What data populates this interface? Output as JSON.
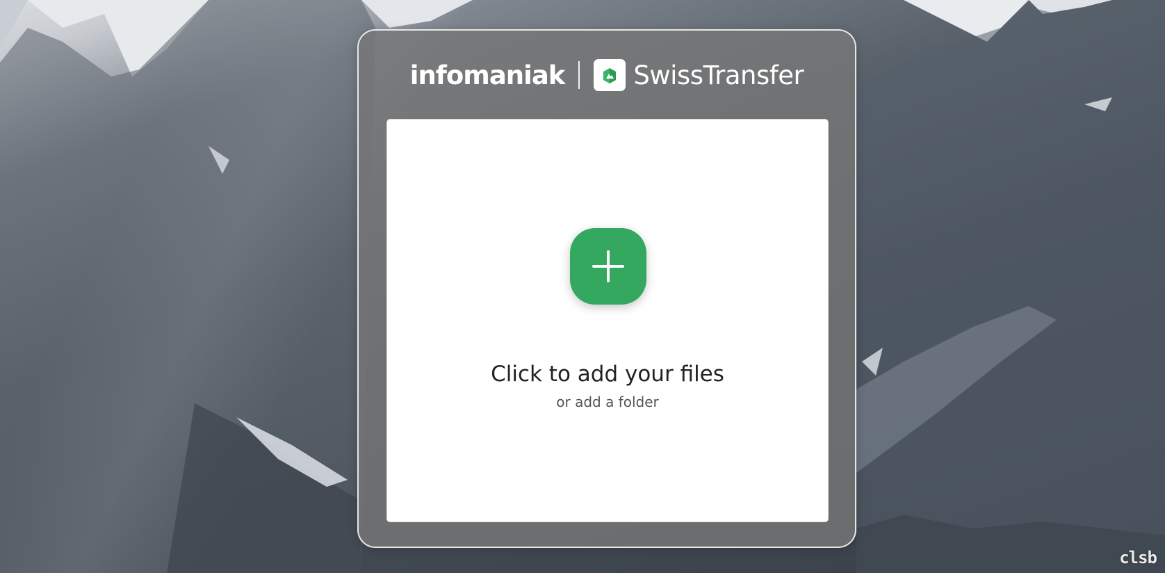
{
  "brand": {
    "company": "infomaniak",
    "product": "SwissTransfer"
  },
  "upload": {
    "title": "Click to add your files",
    "or_text": "or",
    "folder_link": "add a folder"
  },
  "watermark": "clsb",
  "colors": {
    "accent": "#33a85e",
    "card_glass": "#767676",
    "drop_zone": "#ffffff"
  },
  "icons": {
    "add": "plus-icon",
    "app_logo": "swisstransfer-logo-icon"
  }
}
